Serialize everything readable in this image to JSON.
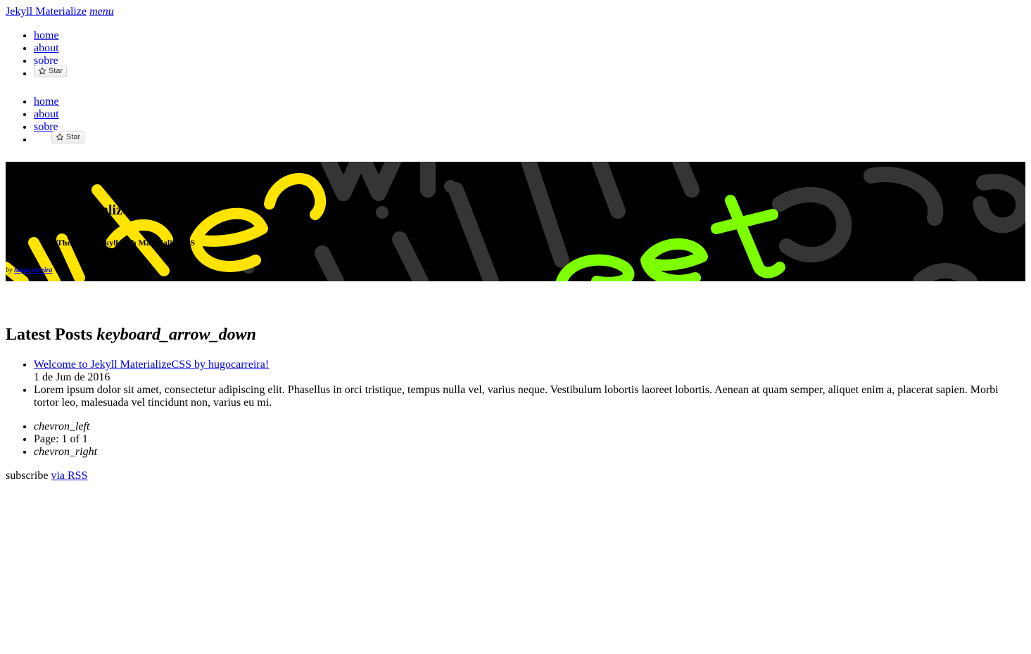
{
  "brand": {
    "title": "Jekyll Materialize",
    "menu_icon": "menu"
  },
  "nav_primary": {
    "items": [
      {
        "label": "home"
      },
      {
        "label": "about"
      },
      {
        "label": "sobre"
      }
    ],
    "star_label": "Star"
  },
  "nav_mobile": {
    "items": [
      {
        "label": "home"
      },
      {
        "label": "about"
      },
      {
        "label": "sobre"
      }
    ],
    "star_label": "Star"
  },
  "banner": {
    "title": "MaterializeCSS",
    "subtitle": "A Theme for Jekyll with MaterializeCSS",
    "by_prefix": "by",
    "author": "hugocarreira",
    "background_words": [
      "when",
      "get",
      "what"
    ],
    "colors": {
      "yellow": "#ffe400",
      "green": "#7dff00",
      "gray": "#3a3a3a"
    }
  },
  "main": {
    "heading": "Latest Posts",
    "heading_icon": "keyboard_arrow_down",
    "posts": [
      {
        "title": "Welcome to Jekyll MaterializeCSS by hugocarreira!",
        "date": "1 de Jun de 2016",
        "excerpt": "Lorem ipsum dolor sit amet, consectetur adipiscing elit. Phasellus in orci tristique, tempus nulla vel, varius neque. Vestibulum lobortis laoreet lobortis. Aenean at quam semper, aliquet enim a, placerat sapien. Morbi tortor leo, malesuada vel tincidunt non, varius eu mi."
      }
    ]
  },
  "pagination": {
    "prev_icon": "chevron_left",
    "page_text": "Page: 1 of 1",
    "next_icon": "chevron_right"
  },
  "footer": {
    "prefix": "subscribe",
    "link": "via RSS"
  }
}
